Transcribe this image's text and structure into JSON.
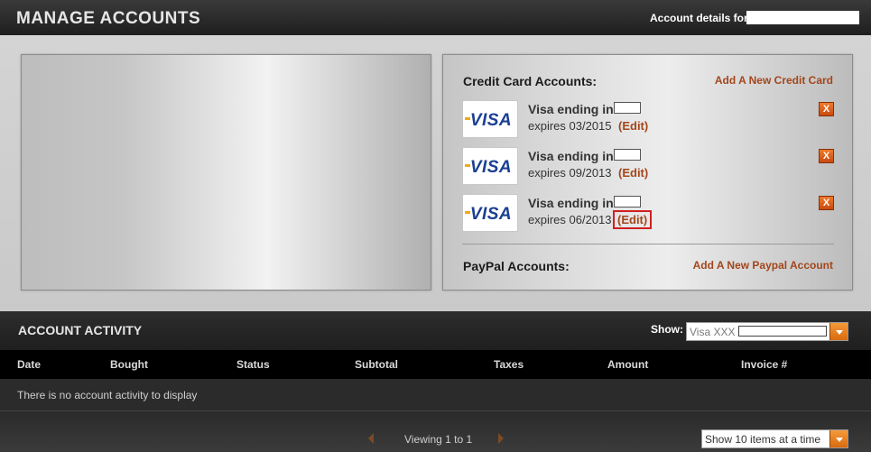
{
  "header": {
    "title": "MANAGE ACCOUNTS",
    "account_label": "Account details for"
  },
  "credit_cards": {
    "heading": "Credit Card Accounts:",
    "add_label": "Add A New Credit Card",
    "cards": [
      {
        "brand": "VISA",
        "title": "Visa ending in",
        "expires": "expires 03/2015",
        "edit": "(Edit)",
        "delete": "X"
      },
      {
        "brand": "VISA",
        "title": "Visa ending in",
        "expires": "expires 09/2013",
        "edit": "(Edit)",
        "delete": "X"
      },
      {
        "brand": "VISA",
        "title": "Visa ending in",
        "expires": "expires 06/2013",
        "edit": "(Edit)",
        "delete": "X"
      }
    ]
  },
  "paypal": {
    "heading": "PayPal Accounts:",
    "add_label": "Add A New Paypal Account"
  },
  "activity": {
    "title": "ACCOUNT ACTIVITY",
    "show_label": "Show:",
    "filter_value": "Visa XXX",
    "columns": [
      "Date",
      "Bought",
      "Status",
      "Subtotal",
      "Taxes",
      "Amount",
      "Invoice #"
    ],
    "empty_message": "There is no account activity to display"
  },
  "pagination": {
    "viewing": "Viewing 1 to 1",
    "per_page": "Show 10 items at a time"
  },
  "colors": {
    "accent": "#a3461b",
    "button_orange": "#e06a1a",
    "highlight_box": "#d21f1f"
  }
}
